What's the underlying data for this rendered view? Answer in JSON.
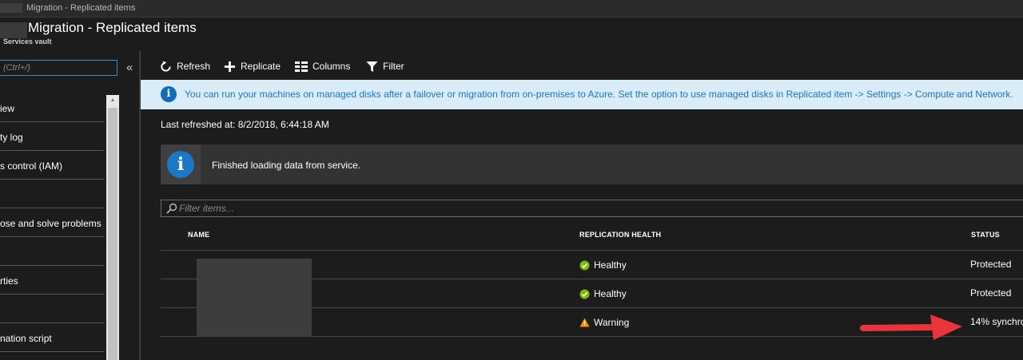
{
  "window": {
    "breadcrumb": "Migration - Replicated items"
  },
  "header": {
    "title": "Migration - Replicated items",
    "subtitle": "Services vault"
  },
  "sidebar": {
    "search_placeholder": "(Ctrl+/)",
    "collapse_glyph": "«",
    "scroll_up_glyph": "▲",
    "items": [
      {
        "label": "iew"
      },
      {
        "label": "ty log"
      },
      {
        "label": "s control (IAM)"
      },
      {
        "label": ""
      },
      {
        "label": "ose and solve problems"
      },
      {
        "label": ""
      },
      {
        "label": "rties"
      },
      {
        "label": ""
      },
      {
        "label": "nation script"
      }
    ]
  },
  "toolbar": {
    "refresh_label": "Refresh",
    "replicate_label": "Replicate",
    "columns_label": "Columns",
    "filter_label": "Filter"
  },
  "banner": {
    "icon_glyph": "i",
    "text": "You can run your machines on managed disks after a failover or migration from on-premises to Azure. Set the option to use managed disks in Replicated item -> Settings -> Compute and Network."
  },
  "last_refreshed": "Last refreshed at: 8/2/2018, 6:44:18 AM",
  "notice": {
    "icon_glyph": "i",
    "text": "Finished loading data from service."
  },
  "filter": {
    "placeholder": "Filter items..."
  },
  "table": {
    "columns": {
      "name": "NAME",
      "health": "REPLICATION HEALTH",
      "status": "STATUS"
    },
    "rows": [
      {
        "name": "",
        "health": "Healthy",
        "health_icon": "check-circle-icon",
        "status": "Protected"
      },
      {
        "name": "",
        "health": "Healthy",
        "health_icon": "check-circle-icon",
        "status": "Protected"
      },
      {
        "name": "",
        "health": "Warning",
        "health_icon": "warning-triangle-icon",
        "status": "14% synchro"
      }
    ]
  },
  "colors": {
    "accent": "#0f6cbd",
    "healthy": "#7fba00",
    "warning": "#ff8c00",
    "annotation_arrow": "#e8343a",
    "banner_bg": "#d9ecf8",
    "banner_text": "#1877c4"
  }
}
